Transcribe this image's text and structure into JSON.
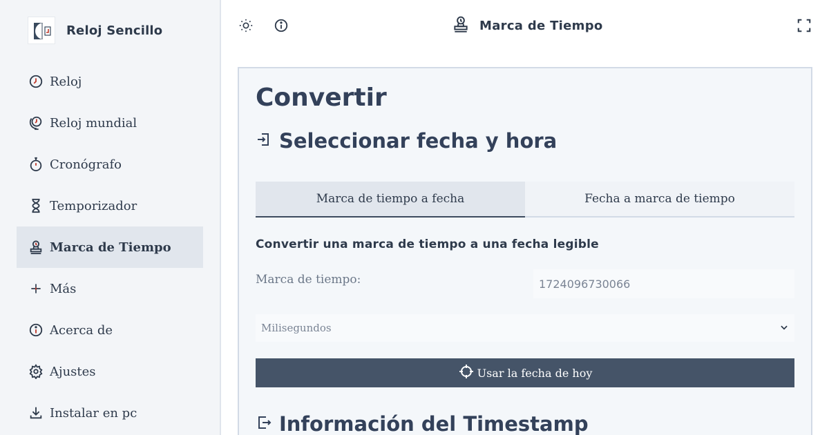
{
  "app": {
    "name": "Reloj Sencillo"
  },
  "sidebar": {
    "items": [
      {
        "label": "Reloj",
        "icon": "clock-icon"
      },
      {
        "label": "Reloj mundial",
        "icon": "world-clock-icon"
      },
      {
        "label": "Cronógrafo",
        "icon": "stopwatch-icon"
      },
      {
        "label": "Temporizador",
        "icon": "hourglass-icon"
      },
      {
        "label": "Marca de Tiempo",
        "icon": "stamp-icon",
        "active": true
      },
      {
        "label": "Más",
        "icon": "plus-icon"
      },
      {
        "label": "Acerca de",
        "icon": "info-icon"
      },
      {
        "label": "Ajustes",
        "icon": "gear-icon"
      },
      {
        "label": "Instalar en pc",
        "icon": "download-icon"
      }
    ]
  },
  "header": {
    "title": "Marca de Tiempo",
    "icons": [
      "sun-icon",
      "info-icon",
      "stamp-icon",
      "fullscreen-icon"
    ]
  },
  "main": {
    "title": "Convertir",
    "section_title": "Seleccionar fecha y hora",
    "tabs": [
      {
        "label": "Marca de tiempo a fecha",
        "active": true
      },
      {
        "label": "Fecha a marca de tiempo",
        "active": false
      }
    ],
    "subtitle": "Convertir una marca de tiempo a una fecha legible",
    "timestamp_label": "Marca de tiempo:",
    "timestamp_value": "1724096730066",
    "unit_selected": "Milisegundos",
    "today_button": "Usar la fecha de hoy",
    "info_title": "Información del Timestamp"
  },
  "colors": {
    "sidebar_bg": "#f3f5f8",
    "active_bg": "#e1e6ed",
    "button_bg": "#455468",
    "text": "#2e3a4b",
    "card_bg": "#f4f7fa"
  }
}
